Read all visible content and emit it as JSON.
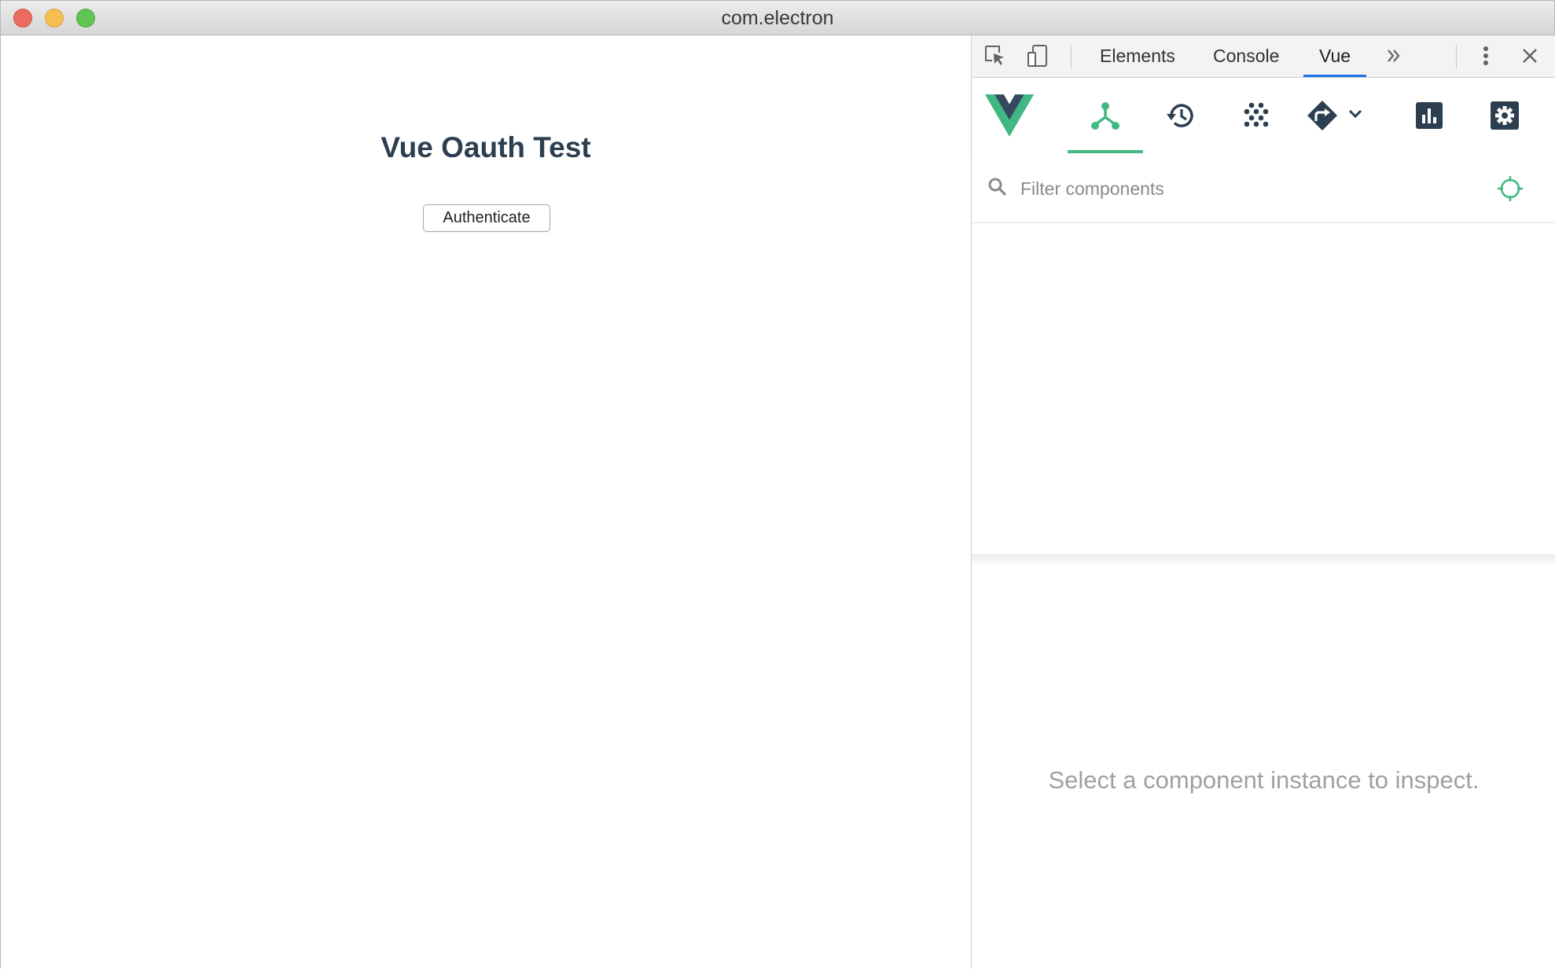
{
  "window": {
    "title": "com.electron"
  },
  "app": {
    "heading": "Vue Oauth Test",
    "authenticate_label": "Authenticate"
  },
  "devtools": {
    "tabs": [
      {
        "label": "Elements",
        "active": false
      },
      {
        "label": "Console",
        "active": false
      },
      {
        "label": "Vue",
        "active": true
      }
    ],
    "vue_toolbar": {
      "buttons": [
        {
          "name": "vue-logo",
          "active": false
        },
        {
          "name": "components-icon",
          "active": true
        },
        {
          "name": "history-icon",
          "active": false
        },
        {
          "name": "vuex-icon",
          "active": false
        },
        {
          "name": "routing-icon",
          "active": false
        },
        {
          "name": "performance-icon",
          "active": false
        },
        {
          "name": "settings-icon",
          "active": false
        }
      ]
    },
    "filter": {
      "placeholder": "Filter components",
      "value": ""
    },
    "inspector_message": "Select a component instance to inspect."
  },
  "colors": {
    "vue_green": "#42b983",
    "vue_dark": "#35495e",
    "toolbar_icon": "#2c3e50",
    "tab_active_underline": "#1a73e8",
    "heading": "#2c3e50"
  }
}
